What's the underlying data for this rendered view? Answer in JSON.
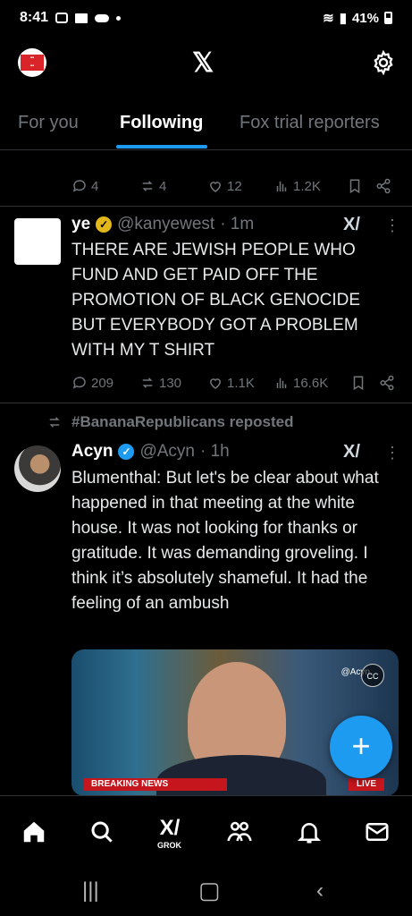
{
  "status": {
    "time": "8:41",
    "battery": "41%"
  },
  "nav": {
    "logo": "𝕏"
  },
  "tabs": [
    {
      "label": "For you"
    },
    {
      "label": "Following"
    },
    {
      "label": "Fox trial reporters"
    }
  ],
  "tweet0": {
    "replies": "4",
    "reposts": "4",
    "likes": "12",
    "views": "1.2K"
  },
  "tweet1": {
    "name": "ye",
    "handle": "@kanyewest",
    "time": "· 1m",
    "text": "THERE ARE JEWISH PEOPLE WHO FUND AND GET PAID OFF THE PROMOTION OF BLACK GENOCIDE BUT EVERYBODY GOT A PROBLEM WITH MY T SHIRT",
    "replies": "209",
    "reposts": "130",
    "likes": "1.1K",
    "views": "16.6K"
  },
  "tweet2": {
    "repost_label": "#BananaRepublicans reposted",
    "name": "Acyn",
    "handle": "@Acyn",
    "time": "· 1h",
    "text": "Blumenthal: But let's be clear about what happened in that meeting at the white house. It was not looking for thanks or gratitude. It was demanding groveling. I think it’s absolutely shameful. It had the feeling of an ambush",
    "media_breaking": "BREAKING NEWS",
    "media_live": "LIVE",
    "media_watermark": "@Acyn"
  },
  "bottom": {
    "grok_label": "GROK"
  },
  "fab": {
    "symbol": "+"
  },
  "colors": {
    "accent": "#1d9bf0",
    "background": "#000000",
    "muted": "#71767b"
  }
}
